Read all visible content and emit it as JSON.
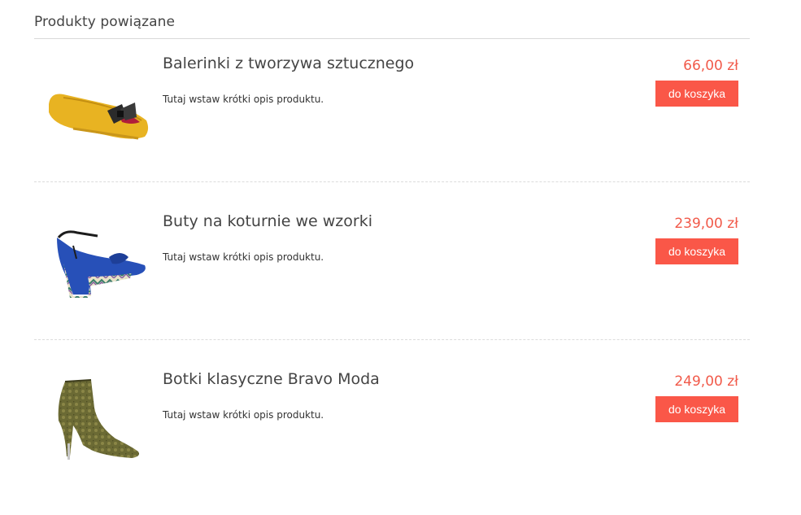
{
  "section": {
    "title": "Produkty powiązane"
  },
  "products": [
    {
      "name": "Balerinki z tworzywa sztucznego",
      "description": "Tutaj wstaw krótki opis produktu.",
      "price": "66,00 zł",
      "button_label": "do koszyka",
      "image": "yellow-ballerina-shoe"
    },
    {
      "name": "Buty na koturnie we wzorki",
      "description": "Tutaj wstaw krótki opis produktu.",
      "price": "239,00 zł",
      "button_label": "do koszyka",
      "image": "patterned-wedge-sandal"
    },
    {
      "name": "Botki klasyczne Bravo Moda",
      "description": "Tutaj wstaw krótki opis produktu.",
      "price": "249,00 zł",
      "button_label": "do koszyka",
      "image": "olive-stiletto-ankle-boot"
    }
  ],
  "colors": {
    "accent": "#fa5748",
    "price": "#f15a4a"
  }
}
